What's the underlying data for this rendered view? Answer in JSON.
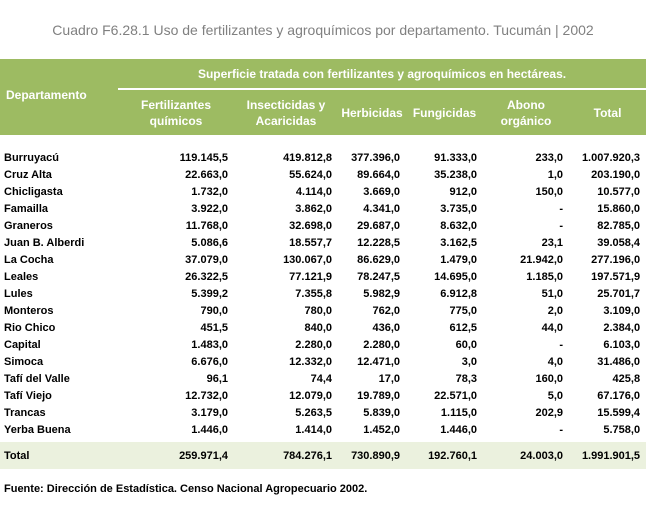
{
  "title": "Cuadro F6.28.1 Uso de fertilizantes y agroquímicos por departamento. Tucumán | 2002",
  "header": {
    "departamento": "Departamento",
    "super": "Superficie tratada con fertilizantes y agroquímicos en hectáreas.",
    "columns": [
      "Fertilizantes químicos",
      "Insecticidas y Acaricidas",
      "Herbicidas",
      "Fungicidas",
      "Abono orgánico",
      "Total"
    ]
  },
  "rows": [
    {
      "dep": "Burruyacú",
      "v": [
        "119.145,5",
        "419.812,8",
        "377.396,0",
        "91.333,0",
        "233,0",
        "1.007.920,3"
      ]
    },
    {
      "dep": "Cruz Alta",
      "v": [
        "22.663,0",
        "55.624,0",
        "89.664,0",
        "35.238,0",
        "1,0",
        "203.190,0"
      ]
    },
    {
      "dep": "Chicligasta",
      "v": [
        "1.732,0",
        "4.114,0",
        "3.669,0",
        "912,0",
        "150,0",
        "10.577,0"
      ]
    },
    {
      "dep": "Famailla",
      "v": [
        "3.922,0",
        "3.862,0",
        "4.341,0",
        "3.735,0",
        "-",
        "15.860,0"
      ]
    },
    {
      "dep": "Graneros",
      "v": [
        "11.768,0",
        "32.698,0",
        "29.687,0",
        "8.632,0",
        "-",
        "82.785,0"
      ]
    },
    {
      "dep": "Juan B. Alberdi",
      "v": [
        "5.086,6",
        "18.557,7",
        "12.228,5",
        "3.162,5",
        "23,1",
        "39.058,4"
      ]
    },
    {
      "dep": "La Cocha",
      "v": [
        "37.079,0",
        "130.067,0",
        "86.629,0",
        "1.479,0",
        "21.942,0",
        "277.196,0"
      ]
    },
    {
      "dep": "Leales",
      "v": [
        "26.322,5",
        "77.121,9",
        "78.247,5",
        "14.695,0",
        "1.185,0",
        "197.571,9"
      ]
    },
    {
      "dep": "Lules",
      "v": [
        "5.399,2",
        "7.355,8",
        "5.982,9",
        "6.912,8",
        "51,0",
        "25.701,7"
      ]
    },
    {
      "dep": "Monteros",
      "v": [
        "790,0",
        "780,0",
        "762,0",
        "775,0",
        "2,0",
        "3.109,0"
      ]
    },
    {
      "dep": "Rio Chico",
      "v": [
        "451,5",
        "840,0",
        "436,0",
        "612,5",
        "44,0",
        "2.384,0"
      ]
    },
    {
      "dep": "Capital",
      "v": [
        "1.483,0",
        "2.280,0",
        "2.280,0",
        "60,0",
        "-",
        "6.103,0"
      ]
    },
    {
      "dep": "Simoca",
      "v": [
        "6.676,0",
        "12.332,0",
        "12.471,0",
        "3,0",
        "4,0",
        "31.486,0"
      ]
    },
    {
      "dep": "Tafí del Valle",
      "v": [
        "96,1",
        "74,4",
        "17,0",
        "78,3",
        "160,0",
        "425,8"
      ]
    },
    {
      "dep": "Tafí Viejo",
      "v": [
        "12.732,0",
        "12.079,0",
        "19.789,0",
        "22.571,0",
        "5,0",
        "67.176,0"
      ]
    },
    {
      "dep": "Trancas",
      "v": [
        "3.179,0",
        "5.263,5",
        "5.839,0",
        "1.115,0",
        "202,9",
        "15.599,4"
      ]
    },
    {
      "dep": "Yerba Buena",
      "v": [
        "1.446,0",
        "1.414,0",
        "1.452,0",
        "1.446,0",
        "-",
        "5.758,0"
      ]
    }
  ],
  "total": {
    "dep": "Total",
    "v": [
      "259.971,4",
      "784.276,1",
      "730.890,9",
      "192.760,1",
      "24.003,0",
      "1.991.901,5"
    ]
  },
  "source": "Fuente: Dirección de Estadística. Censo Nacional Agropecuario  2002.",
  "colors": {
    "header_bg": "#9dbb62",
    "total_bg": "#ebf1de",
    "title_text": "#808080"
  }
}
